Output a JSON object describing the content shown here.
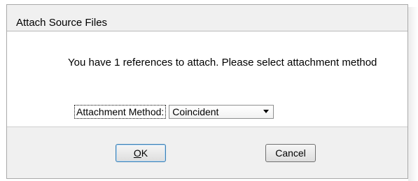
{
  "window": {
    "title": "Attach Source Files"
  },
  "message": {
    "text": "You have 1 references to attach. Please select attachment method"
  },
  "attachment": {
    "label": "Attachment Method:",
    "selected": "Coincident"
  },
  "buttons": {
    "ok_first": "O",
    "ok_rest": "K",
    "cancel": "Cancel"
  }
}
